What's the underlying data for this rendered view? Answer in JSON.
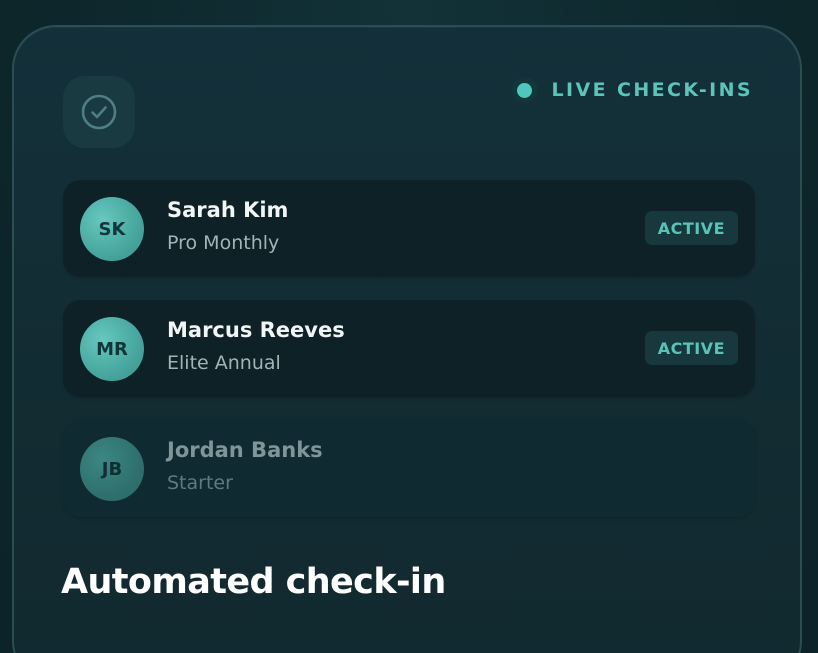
{
  "header": {
    "live_label": "LIVE CHECK-INS"
  },
  "members": [
    {
      "initials": "SK",
      "name": "Sarah Kim",
      "plan": "Pro Monthly",
      "status": "ACTIVE"
    },
    {
      "initials": "MR",
      "name": "Marcus Reeves",
      "plan": "Elite Annual",
      "status": "ACTIVE"
    },
    {
      "initials": "JB",
      "name": "Jordan Banks",
      "plan": "Starter",
      "status": ""
    }
  ],
  "headline": "Automated check-in",
  "colors": {
    "accent": "#4fc7bd",
    "card_background": "#13303a",
    "row_background": "#0d2127"
  },
  "icons": {
    "check_tile": "check-circle-icon",
    "live_indicator": "live-dot-icon"
  }
}
